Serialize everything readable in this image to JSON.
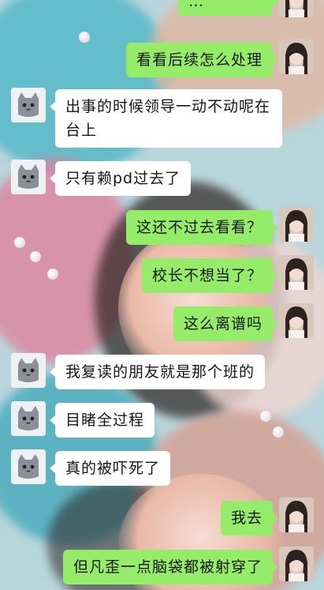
{
  "chat": {
    "messages": [
      {
        "side": "right",
        "text": "…"
      },
      {
        "side": "right",
        "text": "看看后续怎么处理"
      },
      {
        "side": "left",
        "text": "出事的时候领导一动不动呢在台上"
      },
      {
        "side": "left",
        "text": "只有赖pd过去了"
      },
      {
        "side": "right",
        "text": "这还不过去看看？"
      },
      {
        "side": "right",
        "text": "校长不想当了？"
      },
      {
        "side": "right",
        "text": "这么离谱吗"
      },
      {
        "side": "left",
        "text": "我复读的朋友就是那个班的"
      },
      {
        "side": "left",
        "text": "目睹全过程"
      },
      {
        "side": "left",
        "text": "真的被吓死了"
      },
      {
        "side": "right",
        "text": "我去"
      },
      {
        "side": "right",
        "text": "但凡歪一点脑袋都被射穿了"
      }
    ],
    "colors": {
      "incoming_bubble": "#ffffff",
      "outgoing_bubble": "#95ec69",
      "text": "#151515"
    },
    "avatars": {
      "incoming": "gray-cat-avatar-icon",
      "outgoing": "girl-photo-avatar"
    }
  }
}
